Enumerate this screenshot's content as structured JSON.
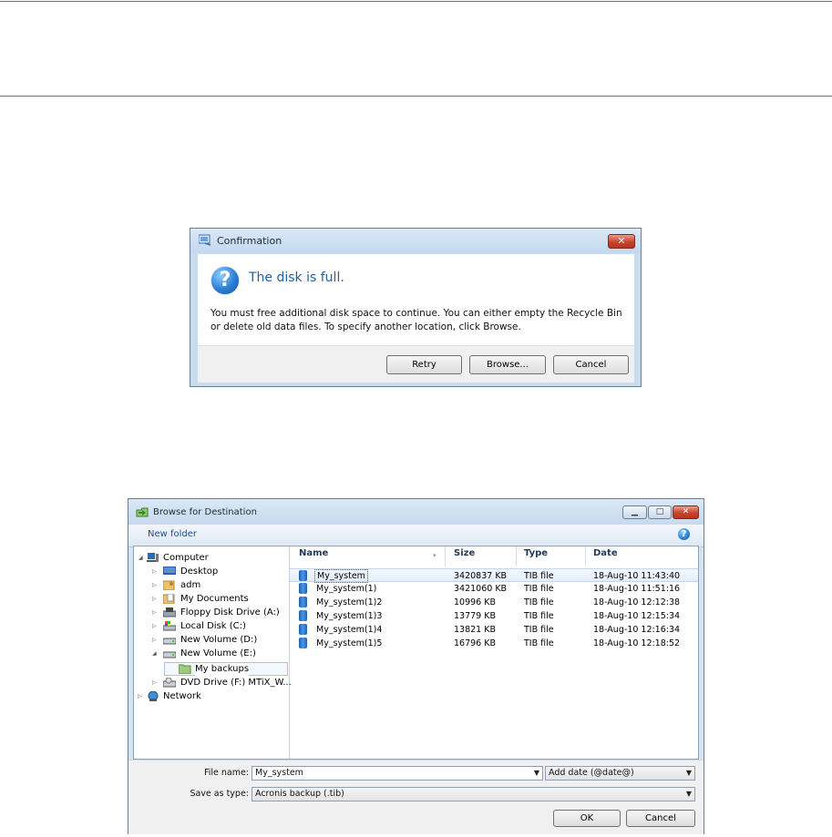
{
  "confirm": {
    "title": "Confirmation",
    "heading": "The disk is full.",
    "message": "You must free additional disk space to continue. You can either empty the Recycle Bin or delete old data files. To specify another location, click Browse.",
    "buttons": {
      "retry": "Retry",
      "browse": "Browse...",
      "cancel": "Cancel"
    }
  },
  "browse": {
    "title": "Browse for Destination",
    "toolbar": {
      "new_folder": "New folder"
    },
    "tree": [
      {
        "label": "Computer",
        "icon": "computer-icon",
        "expanded": true
      },
      {
        "label": "Desktop",
        "icon": "desktop-icon"
      },
      {
        "label": "adm",
        "icon": "user-folder-icon"
      },
      {
        "label": "My Documents",
        "icon": "documents-icon"
      },
      {
        "label": "Floppy Disk Drive (A:)",
        "icon": "floppy-icon"
      },
      {
        "label": "Local Disk (C:)",
        "icon": "system-drive-icon"
      },
      {
        "label": "New Volume (D:)",
        "icon": "drive-icon"
      },
      {
        "label": "New Volume (E:)",
        "icon": "drive-icon",
        "expanded": true
      },
      {
        "label": "My backups",
        "icon": "folder-icon",
        "selected": true
      },
      {
        "label": "DVD Drive (F:) MTiX_W...",
        "icon": "dvd-icon"
      },
      {
        "label": "Network",
        "icon": "network-icon"
      }
    ],
    "columns": {
      "name": "Name",
      "size": "Size",
      "type": "Type",
      "date": "Date"
    },
    "files": [
      {
        "name": "My_system",
        "size": "3420837 KB",
        "type": "TIB file",
        "date": "18-Aug-10 11:43:40"
      },
      {
        "name": "My_system(1)",
        "size": "3421060 KB",
        "type": "TIB file",
        "date": "18-Aug-10 11:51:16"
      },
      {
        "name": "My_system(1)2",
        "size": "10996 KB",
        "type": "TIB file",
        "date": "18-Aug-10 12:12:38"
      },
      {
        "name": "My_system(1)3",
        "size": "13779 KB",
        "type": "TIB file",
        "date": "18-Aug-10 12:15:34"
      },
      {
        "name": "My_system(1)4",
        "size": "13821 KB",
        "type": "TIB file",
        "date": "18-Aug-10 12:16:34"
      },
      {
        "name": "My_system(1)5",
        "size": "16796 KB",
        "type": "TIB file",
        "date": "18-Aug-10 12:18:52"
      }
    ],
    "file_name_label": "File name:",
    "file_name_value": "My_system",
    "add_date_option": "Add date (@date@)",
    "save_as_label": "Save as type:",
    "save_as_value": "Acronis backup (.tib)",
    "ok": "OK",
    "cancel": "Cancel"
  },
  "colors": {
    "rule": "#3f7fa9",
    "heading_blue": "#1f5fa6",
    "close_red": "#c9432d"
  }
}
